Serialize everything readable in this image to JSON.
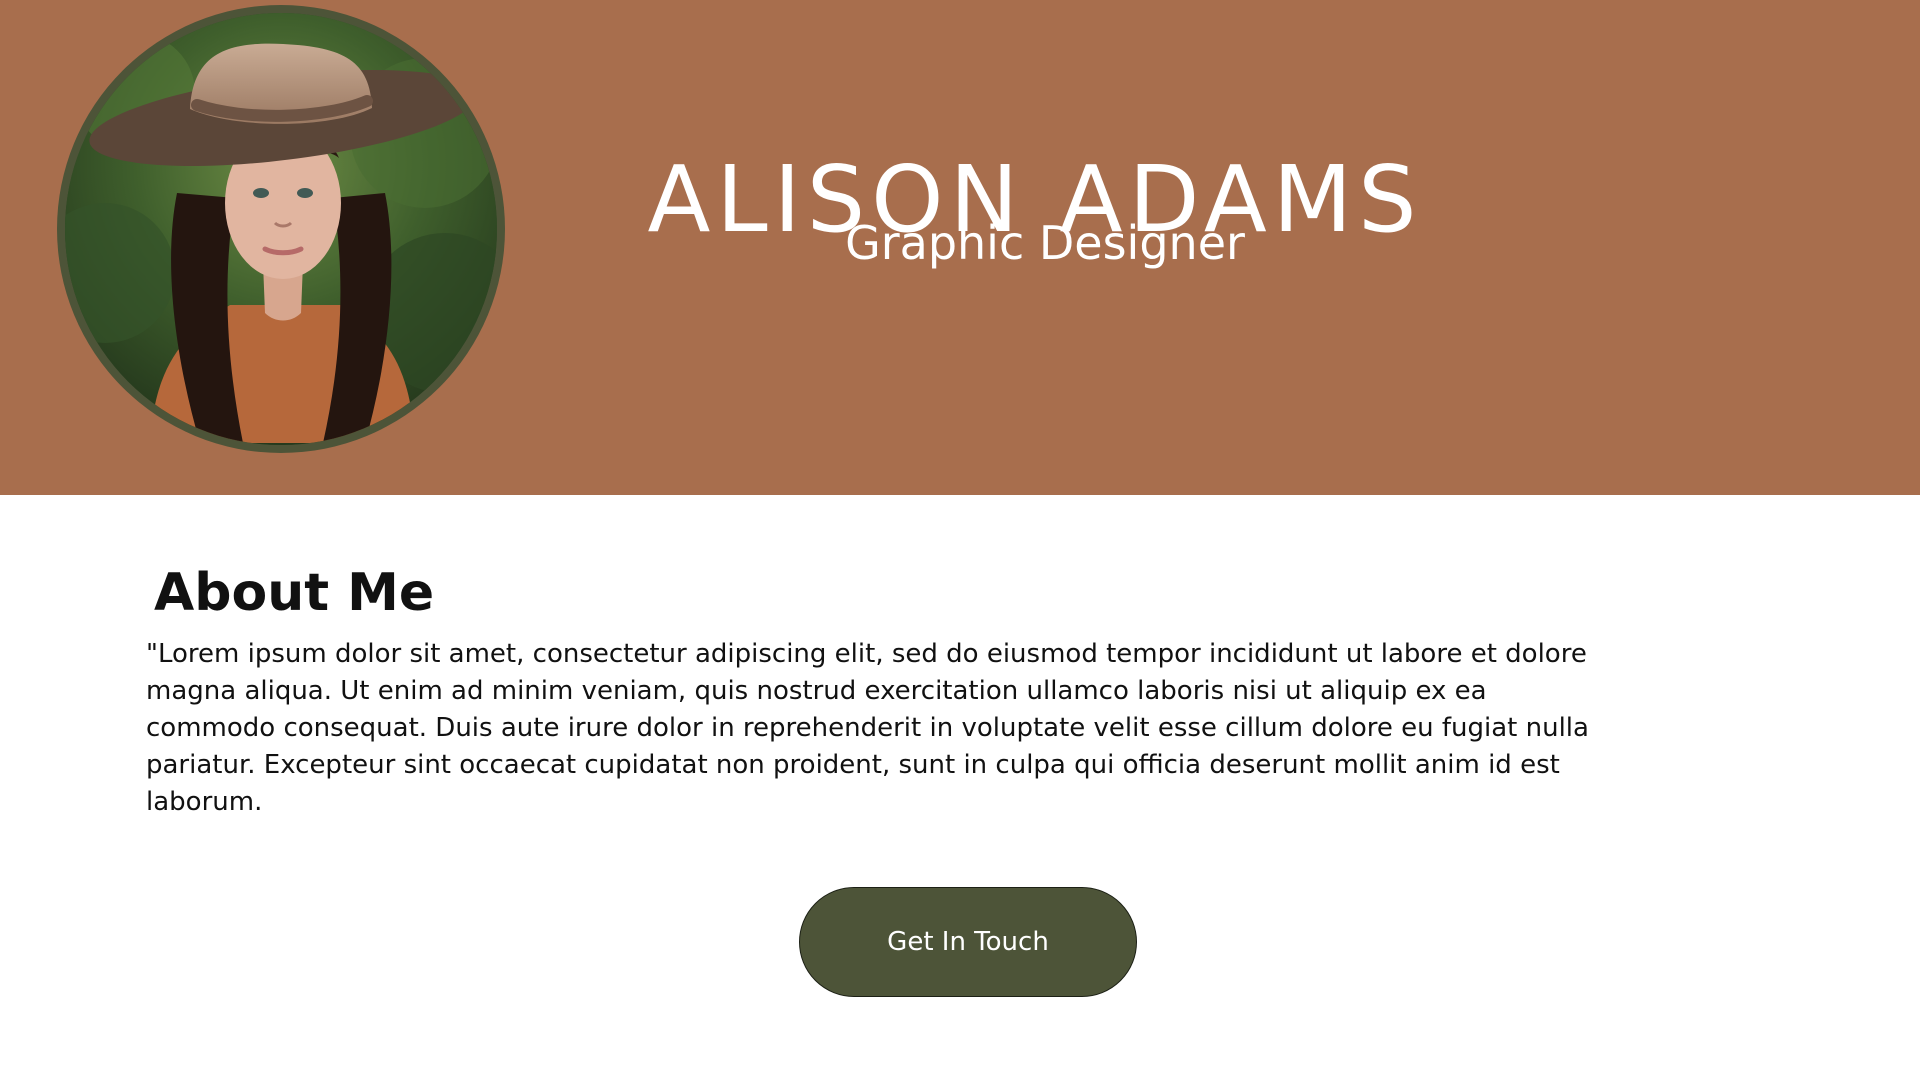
{
  "header": {
    "name": "ALISON ADAMS",
    "role": "Graphic Designer",
    "background_color": "#a86e4d",
    "avatar_ring_color": "#4d5438"
  },
  "about": {
    "title": "About Me",
    "body": "\"Lorem ipsum dolor sit amet, consectetur adipiscing elit, sed do eiusmod tempor incididunt ut labore et dolore magna aliqua. Ut enim ad minim veniam, quis nostrud exercitation ullamco laboris nisi ut aliquip ex ea commodo consequat. Duis aute irure dolor in reprehenderit in voluptate velit esse cillum dolore eu fugiat nulla pariatur. Excepteur sint occaecat cupidatat non proident, sunt in culpa qui officia deserunt mollit anim id est laborum."
  },
  "cta": {
    "label": "Get In Touch",
    "color": "#4d5438"
  }
}
